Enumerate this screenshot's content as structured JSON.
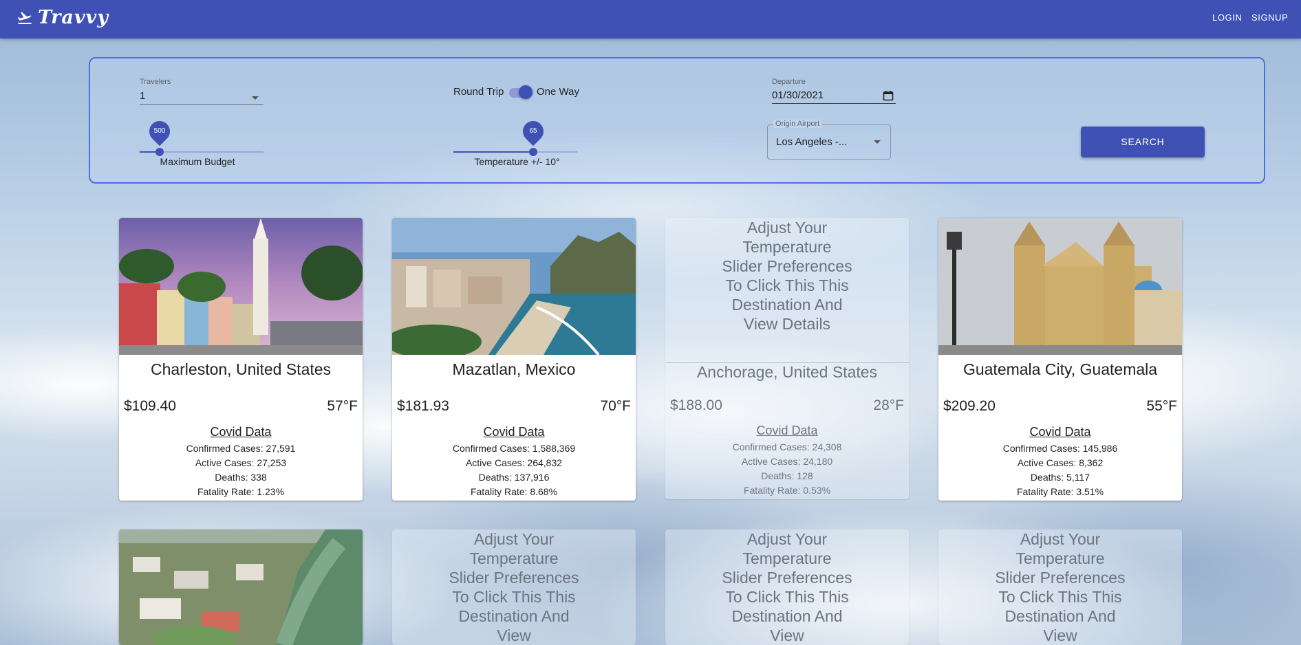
{
  "app": {
    "brand": "Travvy",
    "nav": {
      "login": "LOGIN",
      "signup": "SIGNUP"
    }
  },
  "search": {
    "travelers": {
      "label": "Travelers",
      "value": "1"
    },
    "trip_toggle": {
      "left_label": "Round Trip",
      "right_label": "One Way",
      "selected": "One Way"
    },
    "departure": {
      "label": "Departure",
      "value": "01/30/2021"
    },
    "budget": {
      "value": "500",
      "caption": "Maximum Budget",
      "fraction": 0.16
    },
    "temperature": {
      "value": "65",
      "caption": "Temperature +/- 10°",
      "fraction": 0.65
    },
    "origin": {
      "label": "Origin Airport",
      "value": "Los Angeles -..."
    },
    "button_label": "SEARCH"
  },
  "ghost_message": "Adjust Your Temperature Slider Preferences To Click This This Destination And View Details",
  "cards": [
    {
      "city": "Charleston, United States",
      "price": "$109.40",
      "temp": "57°F",
      "covid_title": "Covid Data",
      "confirmed": "Confirmed Cases: 27,591",
      "active": "Active Cases: 27,253",
      "deaths": "Deaths: 338",
      "fatality": "Fatality Rate: 1.23%"
    },
    {
      "city": "Mazatlan, Mexico",
      "price": "$181.93",
      "temp": "70°F",
      "covid_title": "Covid Data",
      "confirmed": "Confirmed Cases: 1,588,369",
      "active": "Active Cases: 264,832",
      "deaths": "Deaths: 137,916",
      "fatality": "Fatality Rate: 8.68%"
    },
    {
      "city": "Anchorage, United States",
      "price": "$188.00",
      "temp": "28°F",
      "covid_title": "Covid Data",
      "confirmed": "Confirmed Cases: 24,308",
      "active": "Active Cases: 24,180",
      "deaths": "Deaths: 128",
      "fatality": "Fatality Rate: 0.53%"
    },
    {
      "city": "Guatemala City, Guatemala",
      "price": "$209.20",
      "temp": "55°F",
      "covid_title": "Covid Data",
      "confirmed": "Confirmed Cases: 145,986",
      "active": "Active Cases: 8,362",
      "deaths": "Deaths: 5,117",
      "fatality": "Fatality Rate: 3.51%"
    }
  ],
  "ghost_message_row2": "Adjust Your Temperature Slider Preferences To Click This This Destination And View"
}
